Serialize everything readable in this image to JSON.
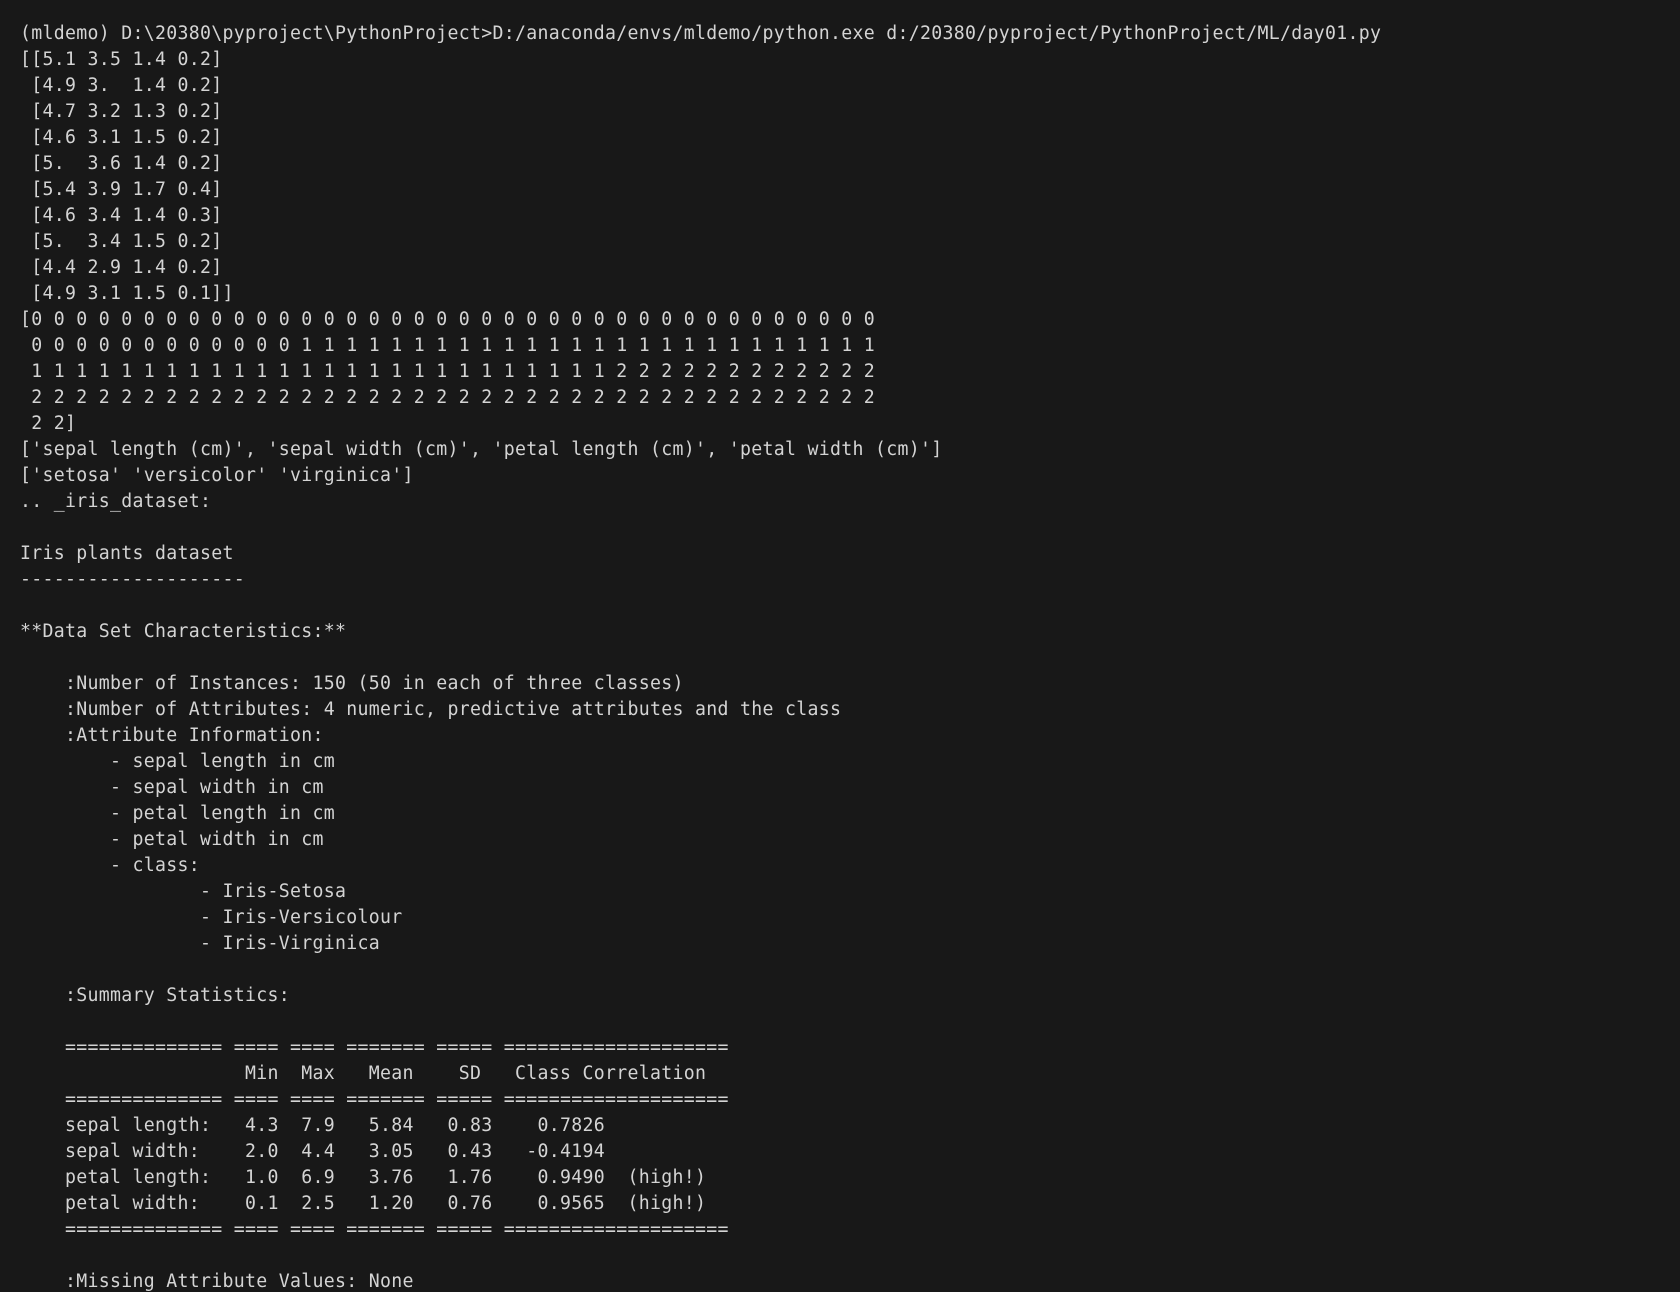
{
  "terminal": {
    "lines": [
      "(mldemo) D:\\20380\\pyproject\\PythonProject>D:/anaconda/envs/mldemo/python.exe d:/20380/pyproject/PythonProject/ML/day01.py",
      "[[5.1 3.5 1.4 0.2]",
      " [4.9 3.  1.4 0.2]",
      " [4.7 3.2 1.3 0.2]",
      " [4.6 3.1 1.5 0.2]",
      " [5.  3.6 1.4 0.2]",
      " [5.4 3.9 1.7 0.4]",
      " [4.6 3.4 1.4 0.3]",
      " [5.  3.4 1.5 0.2]",
      " [4.4 2.9 1.4 0.2]",
      " [4.9 3.1 1.5 0.1]]",
      "[0 0 0 0 0 0 0 0 0 0 0 0 0 0 0 0 0 0 0 0 0 0 0 0 0 0 0 0 0 0 0 0 0 0 0 0 0 0",
      " 0 0 0 0 0 0 0 0 0 0 0 0 1 1 1 1 1 1 1 1 1 1 1 1 1 1 1 1 1 1 1 1 1 1 1 1 1 1",
      " 1 1 1 1 1 1 1 1 1 1 1 1 1 1 1 1 1 1 1 1 1 1 1 1 1 1 2 2 2 2 2 2 2 2 2 2 2 2",
      " 2 2 2 2 2 2 2 2 2 2 2 2 2 2 2 2 2 2 2 2 2 2 2 2 2 2 2 2 2 2 2 2 2 2 2 2 2 2",
      " 2 2]",
      "['sepal length (cm)', 'sepal width (cm)', 'petal length (cm)', 'petal width (cm)']",
      "['setosa' 'versicolor' 'virginica']",
      ".. _iris_dataset:",
      "",
      "Iris plants dataset",
      "--------------------",
      "",
      "**Data Set Characteristics:**",
      "",
      "    :Number of Instances: 150 (50 in each of three classes)",
      "    :Number of Attributes: 4 numeric, predictive attributes and the class",
      "    :Attribute Information:",
      "        - sepal length in cm",
      "        - sepal width in cm",
      "        - petal length in cm",
      "        - petal width in cm",
      "        - class:",
      "                - Iris-Setosa",
      "                - Iris-Versicolour",
      "                - Iris-Virginica",
      "",
      "    :Summary Statistics:",
      "",
      "    ============== ==== ==== ======= ===== ====================",
      "                    Min  Max   Mean    SD   Class Correlation",
      "    ============== ==== ==== ======= ===== ====================",
      "    sepal length:   4.3  7.9   5.84   0.83    0.7826",
      "    sepal width:    2.0  4.4   3.05   0.43   -0.4194",
      "    petal length:   1.0  6.9   3.76   1.76    0.9490  (high!)",
      "    petal width:    0.1  2.5   1.20   0.76    0.9565  (high!)",
      "    ============== ==== ==== ======= ===== ====================",
      "",
      "    :Missing Attribute Values: None"
    ]
  }
}
